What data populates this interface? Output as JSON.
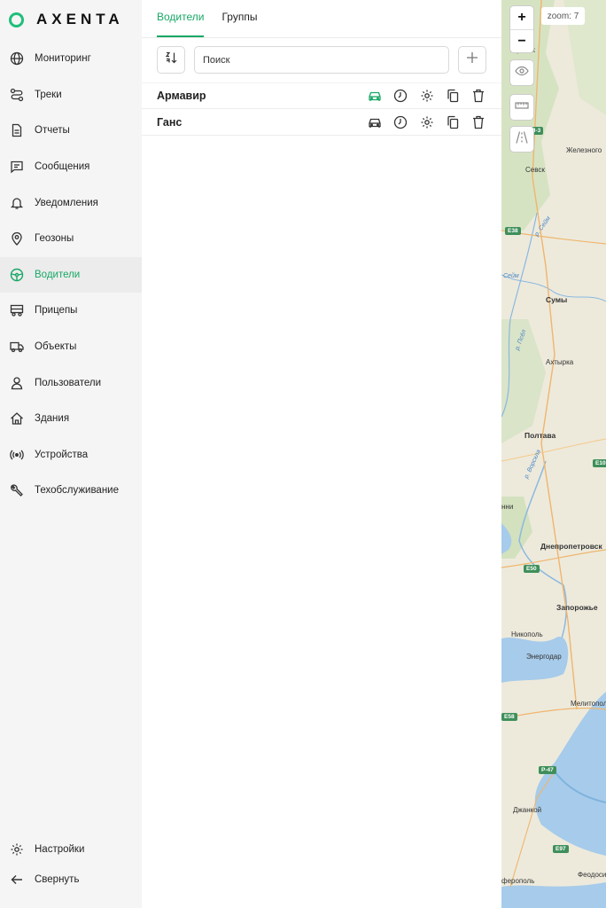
{
  "app": {
    "logo_text": "AXENTA",
    "accent": "#18a866"
  },
  "sidebar": {
    "items": [
      {
        "label": "Мониторинг",
        "icon": "globe-icon"
      },
      {
        "label": "Треки",
        "icon": "route-icon"
      },
      {
        "label": "Отчеты",
        "icon": "document-icon"
      },
      {
        "label": "Сообщения",
        "icon": "message-icon"
      },
      {
        "label": "Уведомления",
        "icon": "bell-icon"
      },
      {
        "label": "Геозоны",
        "icon": "location-pin-icon"
      },
      {
        "label": "Водители",
        "icon": "steering-wheel-icon",
        "active": true
      },
      {
        "label": "Прицепы",
        "icon": "trailer-icon"
      },
      {
        "label": "Объекты",
        "icon": "truck-icon"
      },
      {
        "label": "Пользователи",
        "icon": "user-icon"
      },
      {
        "label": "Здания",
        "icon": "house-icon"
      },
      {
        "label": "Устройства",
        "icon": "broadcast-icon"
      },
      {
        "label": "Техобслуживание",
        "icon": "wrench-icon"
      }
    ],
    "bottom": [
      {
        "label": "Настройки",
        "icon": "gear-icon"
      },
      {
        "label": "Свернуть",
        "icon": "arrow-left-icon"
      }
    ]
  },
  "main": {
    "tabs": [
      {
        "label": "Водители",
        "active": true
      },
      {
        "label": "Группы",
        "active": false
      }
    ],
    "search": {
      "placeholder": "Поиск",
      "value": ""
    },
    "rows": [
      {
        "name": "Армавир",
        "car_color": "#18a866"
      },
      {
        "name": "Ганс",
        "car_color": "#333333"
      }
    ]
  },
  "map": {
    "zoom_label": "zoom: 7",
    "zoom_in": "+",
    "zoom_out": "−",
    "cities": [
      "Брянск",
      "Севск",
      "Железного",
      "Сумы",
      "Ахтырка",
      "Полтава",
      "Днепропетровск",
      "Запорожье",
      "Никополь",
      "Энергодар",
      "Мелитопол",
      "Джанкой",
      "Феодоси",
      "ферополь",
      "нни"
    ],
    "rivers": [
      "р. Сейм",
      "Сейм",
      "р. Псёл",
      "р. Ворскла"
    ],
    "roads": [
      "М-3",
      "E38",
      "E10",
      "E50",
      "E58",
      "P-47",
      "E97"
    ]
  }
}
